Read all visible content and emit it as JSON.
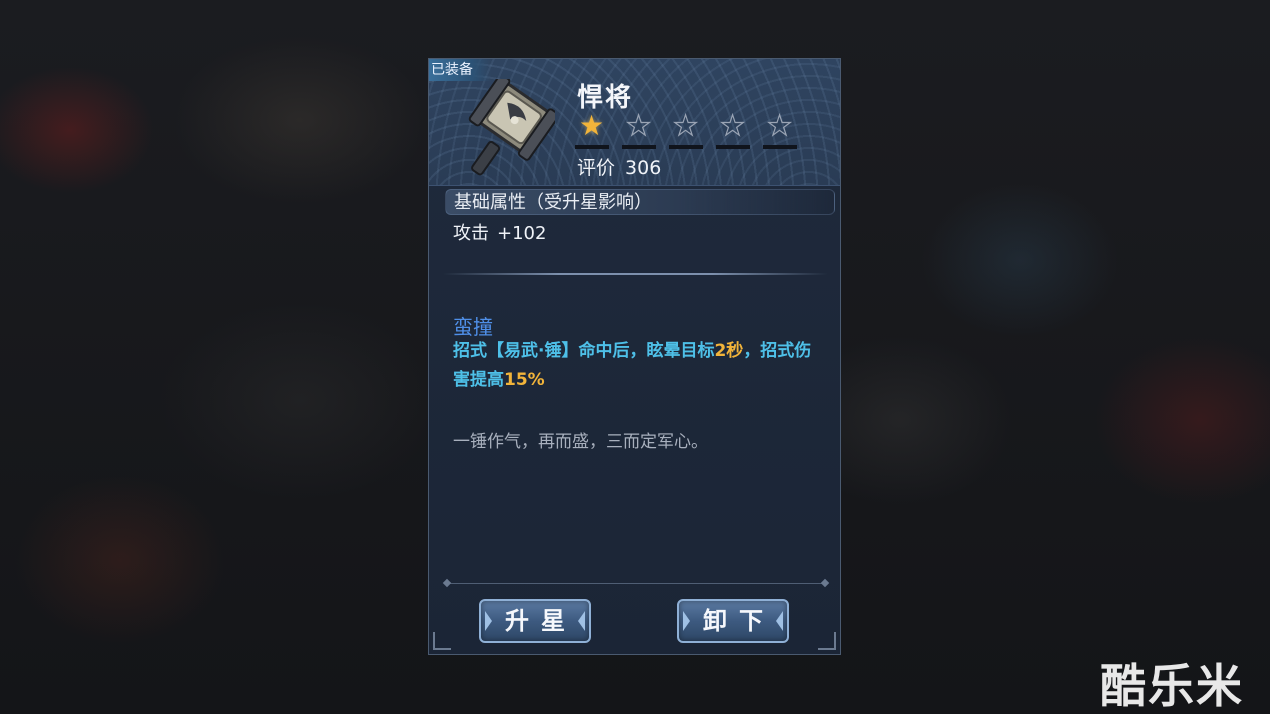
{
  "panel": {
    "equipped_tag": "已装备",
    "item_name": "悍将",
    "stars": {
      "filled": 1,
      "total": 5
    },
    "rating_label": "评价",
    "rating_value": "306",
    "base_section_title": "基础属性（受升星影响）",
    "stat": {
      "label": "攻击",
      "value": "+102"
    },
    "skill": {
      "name": "蛮撞",
      "desc_part1": "招式【易武·锤】命中后，眩晕目标",
      "desc_highlight1": "2秒",
      "desc_part2": "，招式伤害提高",
      "desc_highlight2": "15%"
    },
    "flavor_text": "一锤作气，再而盛，三而定军心。",
    "buttons": {
      "upgrade_label": "升星",
      "unequip_label": "卸下"
    }
  },
  "watermark": "酷乐米",
  "colors": {
    "skill_name": "#4f8fe8",
    "skill_desc": "#4ec0e8",
    "highlight": "#f2b43a",
    "star_filled": "#f2b43a"
  },
  "icons": {
    "item": "war-hammer-icon",
    "star": "star-icon"
  }
}
